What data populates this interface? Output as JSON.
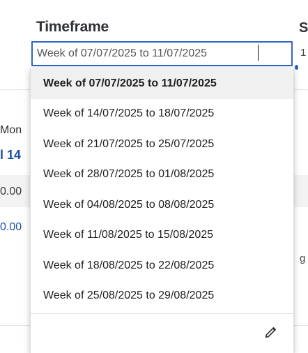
{
  "timeframe": {
    "label": "Timeframe",
    "input_value": "Week of 07/07/2025 to 11/07/2025"
  },
  "background": {
    "right_header_letter": "S",
    "right_header_value": "1",
    "mon_label": "Mon",
    "day_value": "l 14",
    "row_value_1": "0.00",
    "row_value_2": "0.00",
    "right_text": "g r",
    "bottom_text": "",
    "accent_color": "#1f5fbf"
  },
  "dropdown": {
    "options": [
      {
        "label": "Week of 07/07/2025 to 11/07/2025",
        "selected": true
      },
      {
        "label": "Week of 14/07/2025 to 18/07/2025",
        "selected": false
      },
      {
        "label": "Week of 21/07/2025 to 25/07/2025",
        "selected": false
      },
      {
        "label": "Week of 28/07/2025 to 01/08/2025",
        "selected": false
      },
      {
        "label": "Week of 04/08/2025 to 08/08/2025",
        "selected": false
      },
      {
        "label": "Week of 11/08/2025 to 15/08/2025",
        "selected": false
      },
      {
        "label": "Week of 18/08/2025 to 22/08/2025",
        "selected": false
      },
      {
        "label": "Week of 25/08/2025 to 29/08/2025",
        "selected": false
      }
    ],
    "footer_icon": "pencil-icon"
  },
  "colors": {
    "accent": "#2f66c7",
    "selected_row": "#f0f0f0",
    "blue_value": "#1c4fa2"
  }
}
